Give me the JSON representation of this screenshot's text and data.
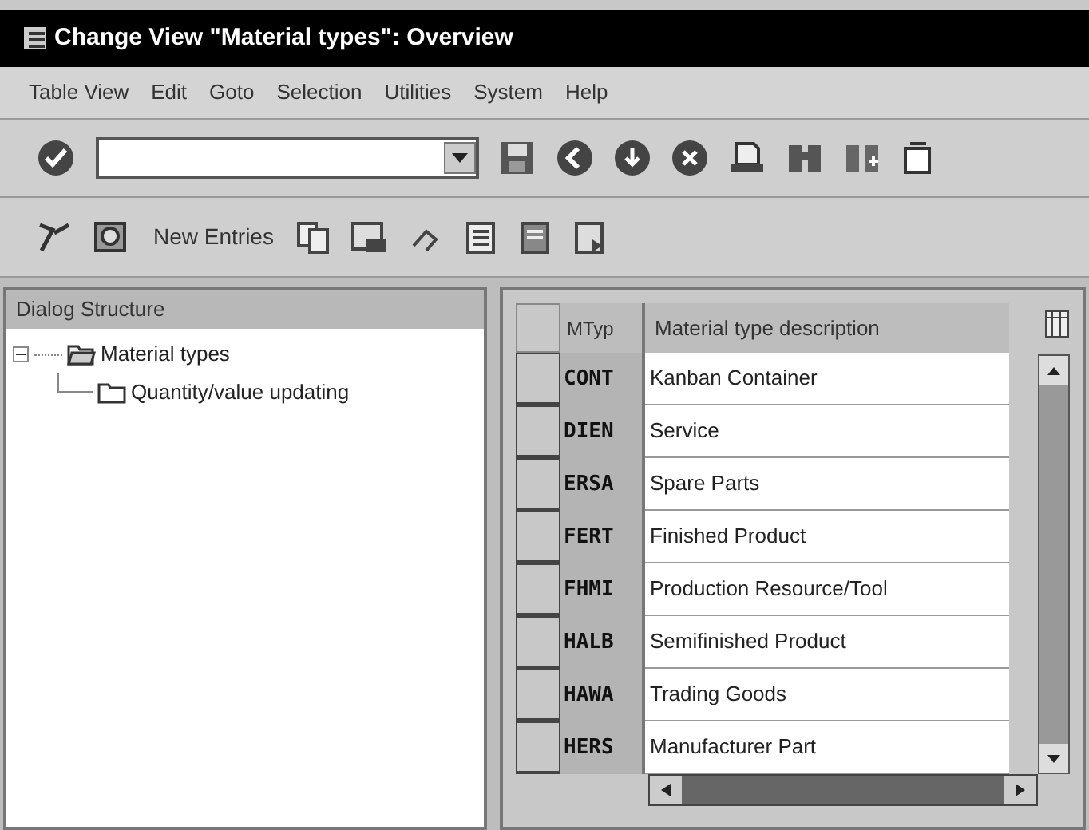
{
  "window": {
    "title": "Change View \"Material types\": Overview"
  },
  "menu": [
    "Table View",
    "Edit",
    "Goto",
    "Selection",
    "Utilities",
    "System",
    "Help"
  ],
  "app_toolbar": {
    "new_entries": "New Entries"
  },
  "dialog_structure": {
    "title": "Dialog Structure",
    "items": [
      {
        "label": "Material types",
        "expanded": true,
        "children": [
          {
            "label": "Quantity/value updating"
          }
        ]
      }
    ]
  },
  "table": {
    "columns": [
      "MTyp",
      "Material type description"
    ],
    "rows": [
      {
        "cells": [
          "CONT",
          "Kanban Container"
        ],
        "selected": false
      },
      {
        "cells": [
          "DIEN",
          "Service"
        ],
        "selected": false
      },
      {
        "cells": [
          "ERSA",
          "Spare Parts"
        ],
        "selected": false
      },
      {
        "cells": [
          "FERT",
          "Finished Product"
        ],
        "selected": false
      },
      {
        "cells": [
          "FHMI",
          "Production Resource/Tool"
        ],
        "selected": false
      },
      {
        "cells": [
          "HALB",
          "Semifinished Product"
        ],
        "selected": false
      },
      {
        "cells": [
          "HAWA",
          "Trading Goods"
        ],
        "selected": false
      },
      {
        "cells": [
          "HERS",
          "Manufacturer Part"
        ],
        "selected": false
      }
    ]
  }
}
